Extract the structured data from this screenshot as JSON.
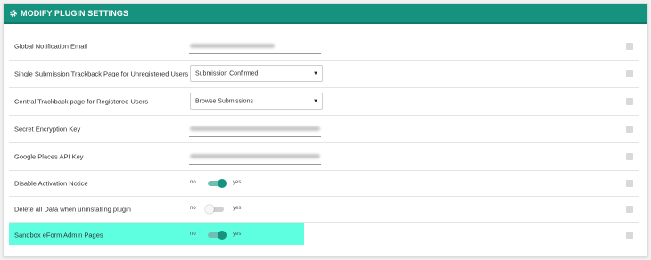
{
  "header": {
    "title": "MODIFY PLUGIN SETTINGS",
    "icon": "gear-icon",
    "color": "#15937f"
  },
  "settings": [
    {
      "label": "Global Notification Email",
      "type": "text"
    },
    {
      "label": "Single Submission Trackback Page for Unregistered Users",
      "type": "select",
      "value": "Submission Confirmed"
    },
    {
      "label": "Central Trackback page for Registered Users",
      "type": "select",
      "value": "Browse Submissions"
    },
    {
      "label": "Secret Encryption Key",
      "type": "text"
    },
    {
      "label": "Google Places API Key",
      "type": "text"
    },
    {
      "label": "Disable Activation Notice",
      "type": "toggle",
      "on": true,
      "no": "no",
      "yes": "yes"
    },
    {
      "label": "Delete all Data when uninstalling plugin",
      "type": "toggle",
      "on": false,
      "no": "no",
      "yes": "yes"
    },
    {
      "label": "Sandbox eForm Admin Pages",
      "type": "toggle",
      "on": true,
      "no": "no",
      "yes": "yes",
      "highlighted": true,
      "highlight_color": "#5effe1"
    }
  ]
}
